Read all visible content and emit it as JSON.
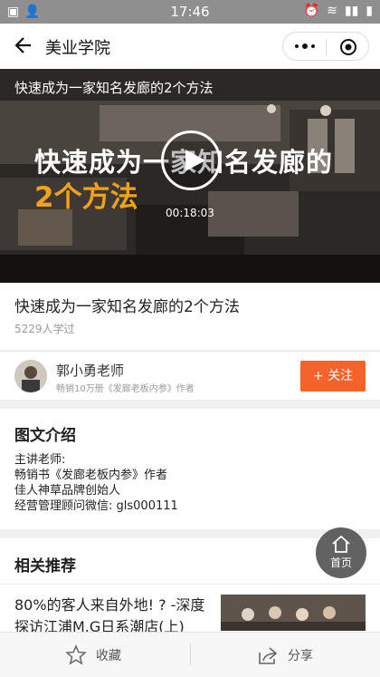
{
  "status_bar": {
    "time": "17:46"
  },
  "nav": {
    "title": "美业学院"
  },
  "video": {
    "header_text": "快速成为一家知名发廊的2个方法",
    "poster_line1": "快速成为一家知名发廊的",
    "poster_line2": "2个方法",
    "duration": "00:18:03"
  },
  "course": {
    "title": "快速成为一家知名发廊的2个方法",
    "learners": "5229人学过"
  },
  "teacher": {
    "name": "郭小勇老师",
    "description": "畅销10万册《发廊老板内参》作者",
    "follow_label": "+ 关注"
  },
  "intro": {
    "heading": "图文介绍",
    "lines": [
      "主讲老师:",
      "畅销书《发廊老板内参》作者",
      "佳人神草品牌创始人",
      "经营管理顾问微信: gls000111"
    ]
  },
  "recommend": {
    "heading": "相关推荐",
    "item_text": "80%的客人来自外地! ? -深度探访江浦M.G日系潮店(上)"
  },
  "home_button": {
    "label": "首页"
  },
  "bottom_bar": {
    "favorite_label": "收藏",
    "share_label": "分享"
  },
  "colors": {
    "accent": "#f4632b",
    "poster_highlight": "#f0a21a"
  },
  "icons": [
    "back-arrow-icon",
    "more-icon",
    "target-icon",
    "play-icon",
    "home-icon",
    "star-icon",
    "share-icon"
  ]
}
